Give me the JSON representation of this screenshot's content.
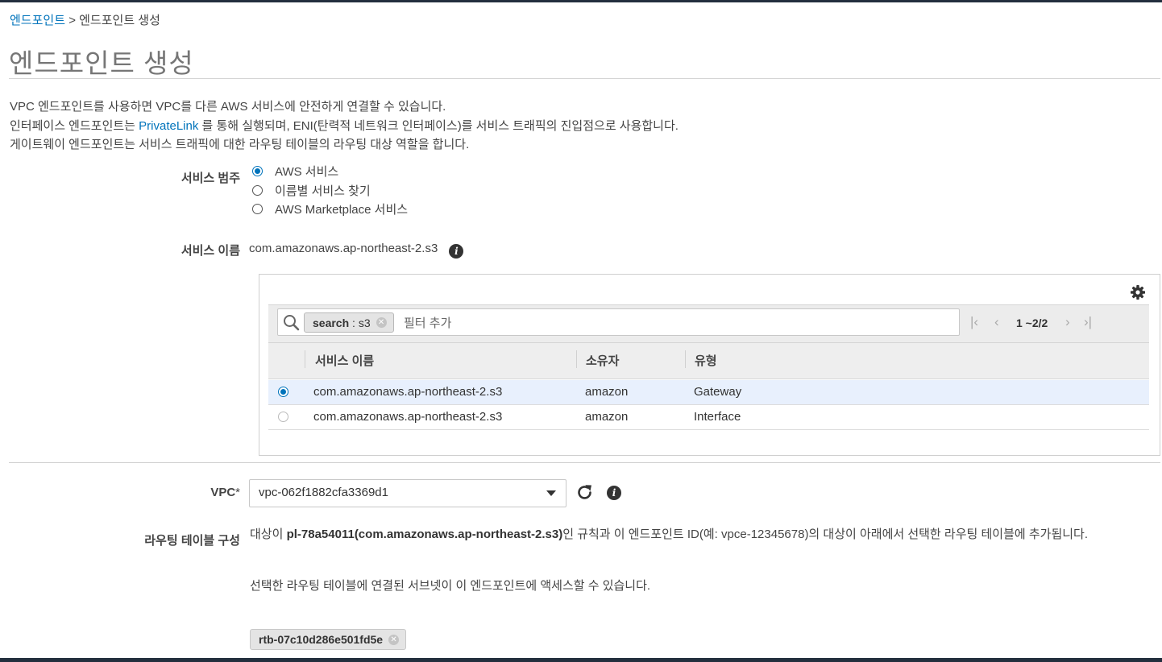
{
  "breadcrumb": {
    "root": "엔드포인트",
    "separator": ">",
    "current": "엔드포인트 생성"
  },
  "page": {
    "title": "엔드포인트 생성"
  },
  "description": {
    "line1": "VPC 엔드포인트를 사용하면 VPC를 다른 AWS 서비스에 안전하게 연결할 수 있습니다.",
    "line2_before": "인터페이스 엔드포인트는 ",
    "line2_link": "PrivateLink",
    "line2_after": " 를 통해 실행되며, ENI(탄력적 네트워크 인터페이스)를 서비스 트래픽의 진입점으로 사용합니다.",
    "line3": "게이트웨이 엔드포인트는 서비스 트래픽에 대한 라우팅 테이블의 라우팅 대상 역할을 합니다."
  },
  "service_category": {
    "label": "서비스 범주",
    "options": [
      {
        "label": "AWS 서비스",
        "selected": true
      },
      {
        "label": "이름별 서비스 찾기",
        "selected": false
      },
      {
        "label": "AWS Marketplace 서비스",
        "selected": false
      }
    ]
  },
  "service_name": {
    "label": "서비스 이름",
    "value": "com.amazonaws.ap-northeast-2.s3",
    "icon": "info-icon"
  },
  "filter": {
    "token_key": "search",
    "token_sep": " : ",
    "token_value": "s3",
    "placeholder": "필터 추가",
    "pagination": "1 ~2/2",
    "icons": [
      "search-icon",
      "gear-icon",
      "first-page-icon",
      "prev-page-icon",
      "next-page-icon",
      "last-page-icon"
    ]
  },
  "table": {
    "columns": [
      "서비스 이름",
      "소유자",
      "유형"
    ],
    "rows": [
      {
        "service": "com.amazonaws.ap-northeast-2.s3",
        "owner": "amazon",
        "type": "Gateway",
        "selected": true
      },
      {
        "service": "com.amazonaws.ap-northeast-2.s3",
        "owner": "amazon",
        "type": "Interface",
        "selected": false
      }
    ]
  },
  "vpc": {
    "label": "VPC",
    "required_mark": "*",
    "value": "vpc-062f1882cfa3369d1",
    "icons": [
      "refresh-icon",
      "info-icon"
    ]
  },
  "route_table": {
    "label": "라우팅 테이블 구성",
    "text_before": "대상이 ",
    "text_bold": "pl-78a54011(com.amazonaws.ap-northeast-2.s3)",
    "text_after": "인 규칙과 이 엔드포인트 ID(예: vpce-12345678)의 대상이 아래에서 선택한 라우팅 테이블에 추가됩니다.",
    "text2": "선택한 라우팅 테이블에 연결된 서브넷이 이 엔드포인트에 액세스할 수 있습니다.",
    "token": "rtb-07c10d286e501fd5e"
  },
  "colors": {
    "link": "#0073bb",
    "selected_row": "#e8f0fd",
    "header_bar": "#232f3e"
  }
}
